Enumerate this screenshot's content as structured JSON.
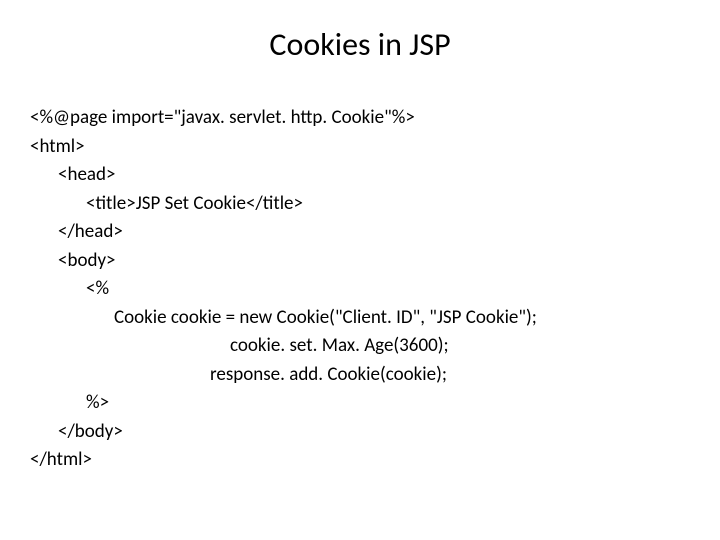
{
  "title": "Cookies in JSP",
  "code": {
    "line1": "<%@page import=\"javax. servlet. http. Cookie\"%>",
    "line2": "<html>",
    "line3": "<head>",
    "line4": "<title>JSP Set Cookie</title>",
    "line5": "</head>",
    "line6": "<body>",
    "line7": "<%",
    "line8": "Cookie cookie = new Cookie(\"Client. ID\", \"JSP Cookie\");",
    "line9": "cookie. set. Max. Age(3600);",
    "line10": "response. add. Cookie(cookie);",
    "line11": "%>",
    "line12": "</body>",
    "line13": "</html>"
  }
}
